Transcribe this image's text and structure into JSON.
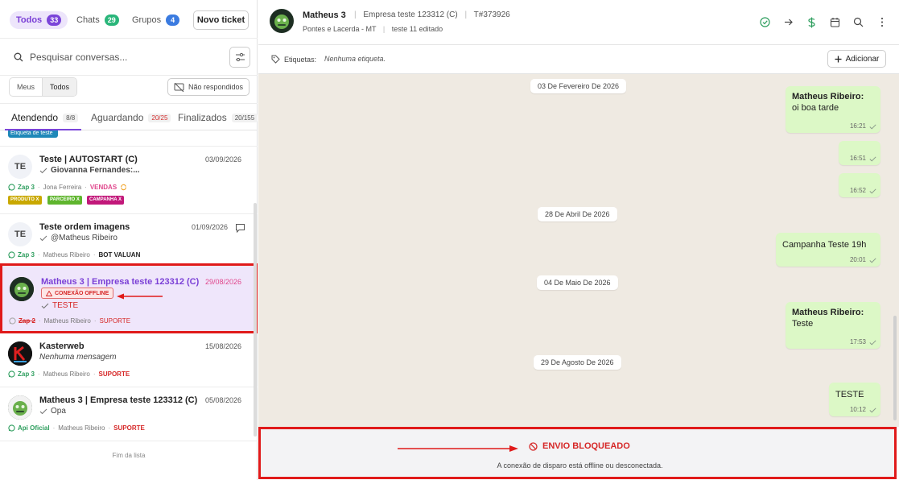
{
  "filters": {
    "todos": {
      "label": "Todos",
      "count": "33"
    },
    "chats": {
      "label": "Chats",
      "count": "29"
    },
    "grupos": {
      "label": "Grupos",
      "count": "4"
    },
    "new_ticket": "Novo ticket"
  },
  "search": {
    "placeholder": "Pesquisar conversas..."
  },
  "view_toggle": {
    "mine": "Meus",
    "all": "Todos"
  },
  "unanswered_label": "Não respondidos",
  "tabs": [
    {
      "label": "Atendendo",
      "count": "8/8"
    },
    {
      "label": "Aguardando",
      "count": "20/25"
    },
    {
      "label": "Finalizados",
      "count": "20/155"
    }
  ],
  "top_tag_text": "Etiqueta de teste",
  "tickets": [
    {
      "initials": "TE",
      "name": "Teste | AUTOSTART (C)",
      "date": "03/09/2026",
      "last_message": "Giovanna Fernandes:...",
      "connection": "Zap 3",
      "agent": "Jona Ferreira",
      "queue": "VENDAS",
      "tags": [
        {
          "label": "PRODUTO X",
          "color": "#c9a800"
        },
        {
          "label": "PARCEIRO X",
          "color": "#5fb52e"
        },
        {
          "label": "CAMPANHA X",
          "color": "#c2187a"
        }
      ]
    },
    {
      "initials": "TE",
      "name": "Teste ordem imagens",
      "date": "01/09/2026",
      "last_message": "@Matheus Ribeiro",
      "connection": "Zap 3",
      "agent": "Matheus Ribeiro",
      "queue": "BOT VALUAN"
    },
    {
      "name": "Matheus 3 | Empresa teste 123312 (C)",
      "date": "29/08/2026",
      "badge": "CONEXÃO OFFLINE",
      "last_message": "TESTE",
      "connection": "Zap 2",
      "agent": "Matheus Ribeiro",
      "queue": "SUPORTE"
    },
    {
      "name": "Kasterweb",
      "date": "15/08/2026",
      "last_message": "Nenhuma mensagem",
      "connection": "Zap 3",
      "agent": "Matheus Ribeiro",
      "queue": "SUPORTE"
    },
    {
      "name": "Matheus 3 | Empresa teste 123312 (C)",
      "date": "05/08/2026",
      "last_message": "Opa",
      "connection": "Api Oficial",
      "agent": "Matheus Ribeiro",
      "queue": "SUPORTE"
    }
  ],
  "end_of_list": "Fim da lista",
  "chat": {
    "contact_name": "Matheus 3",
    "company": "Empresa teste 123312 (C)",
    "ticket_id": "T#373926",
    "location": "Pontes e Lacerda - MT",
    "note": "teste 11 editado",
    "tags_label": "Etiquetas:",
    "tags_empty": "Nenhuma etiqueta.",
    "add_label": "Adicionar",
    "dates": [
      "03 De Fevereiro De 2026",
      "28 De Abril De 2026",
      "04 De Maio De 2026",
      "29 De Agosto De 2026"
    ],
    "messages": [
      {
        "sender": "Matheus Ribeiro:",
        "text": "oi boa tarde",
        "time": "16:21"
      },
      {
        "sender": "",
        "text": "",
        "time": "16:51"
      },
      {
        "sender": "",
        "text": "",
        "time": "16:52"
      },
      {
        "sender": "",
        "text": "Campanha Teste 19h",
        "time": "20:01"
      },
      {
        "sender": "Matheus Ribeiro:",
        "text": "Teste",
        "time": "17:53"
      },
      {
        "sender": "",
        "text": "TESTE",
        "time": "10:12"
      }
    ],
    "blocked_title": "ENVIO BLOQUEADO",
    "blocked_message": "A conexão de disparo está offline ou desconectada."
  },
  "colors": {
    "accent": "#7b45d9",
    "alert": "#d62828",
    "bubble": "#dcf8c6",
    "chat_bg": "#efeae2",
    "whatsapp": "#2e9e5e"
  }
}
